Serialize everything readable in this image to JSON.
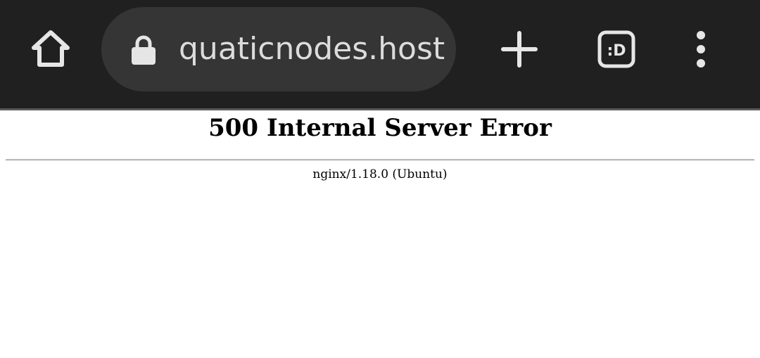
{
  "browser": {
    "url": "quaticnodes.host",
    "tab_switcher_label": ":D",
    "icons": {
      "home": "home-icon",
      "lock": "lock-icon",
      "new_tab": "plus-icon",
      "tab_switcher": "tab-switcher-icon",
      "menu": "kebab-menu-icon"
    },
    "colors": {
      "toolbar": "#202020",
      "omnibox": "#353535",
      "icon": "#e6e6e6"
    }
  },
  "page": {
    "title": "500 Internal Server Error",
    "server_info": "nginx/1.18.0 (Ubuntu)"
  }
}
